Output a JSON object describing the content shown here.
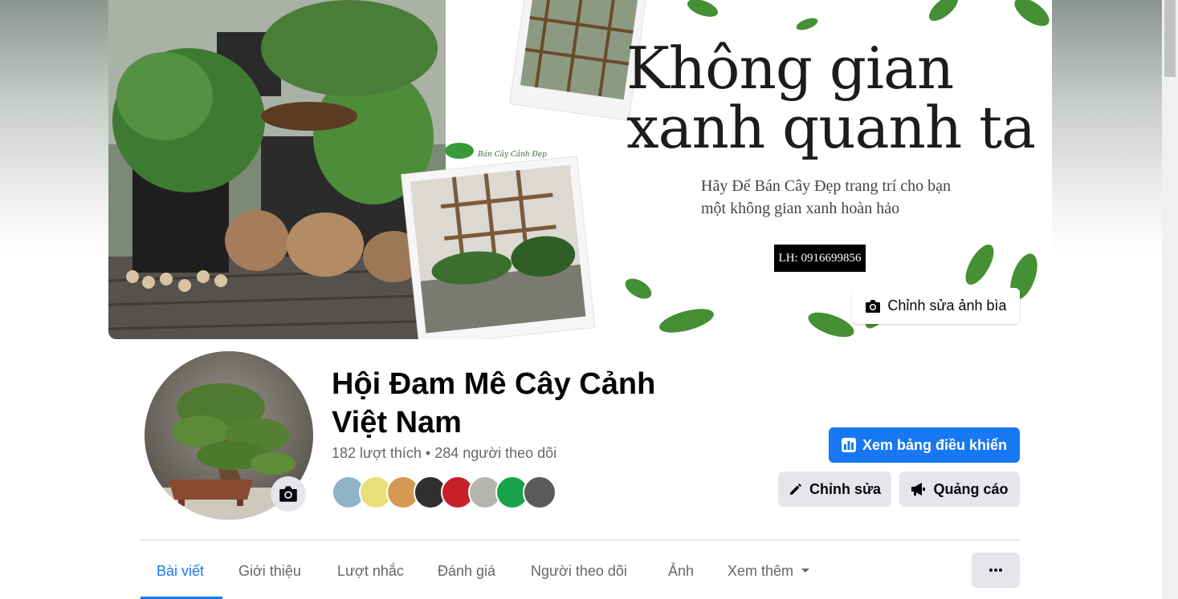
{
  "cover": {
    "title_line1": "Không gian",
    "title_line2": "xanh quanh ta",
    "subtitle_line1": "Hãy Để Bán Cây Đẹp trang trí cho bạn",
    "subtitle_line2": "một không gian xanh hoàn hảo",
    "phone": "LH: 0916699856",
    "edit_cover_label": "Chỉnh sửa ảnh bìa"
  },
  "profile": {
    "name_line1": "Hội Đam Mê Cây Cảnh",
    "name_line2": "Việt Nam",
    "stats": "182 lượt thích • 284 người theo dõi"
  },
  "actions": {
    "dashboard_label": "Xem bảng điều khiển",
    "edit_label": "Chỉnh sửa",
    "ads_label": "Quảng cáo"
  },
  "tabs": [
    {
      "label": "Bài viết",
      "active": true
    },
    {
      "label": "Giới thiệu"
    },
    {
      "label": "Lượt nhắc"
    },
    {
      "label": "Đánh giá"
    },
    {
      "label": "Người theo dõi"
    },
    {
      "label": "Ảnh"
    },
    {
      "label": "Xem thêm"
    }
  ],
  "colors": {
    "accent": "#1877f2",
    "button_gray": "#e4e6eb",
    "text_secondary": "#65676b"
  }
}
